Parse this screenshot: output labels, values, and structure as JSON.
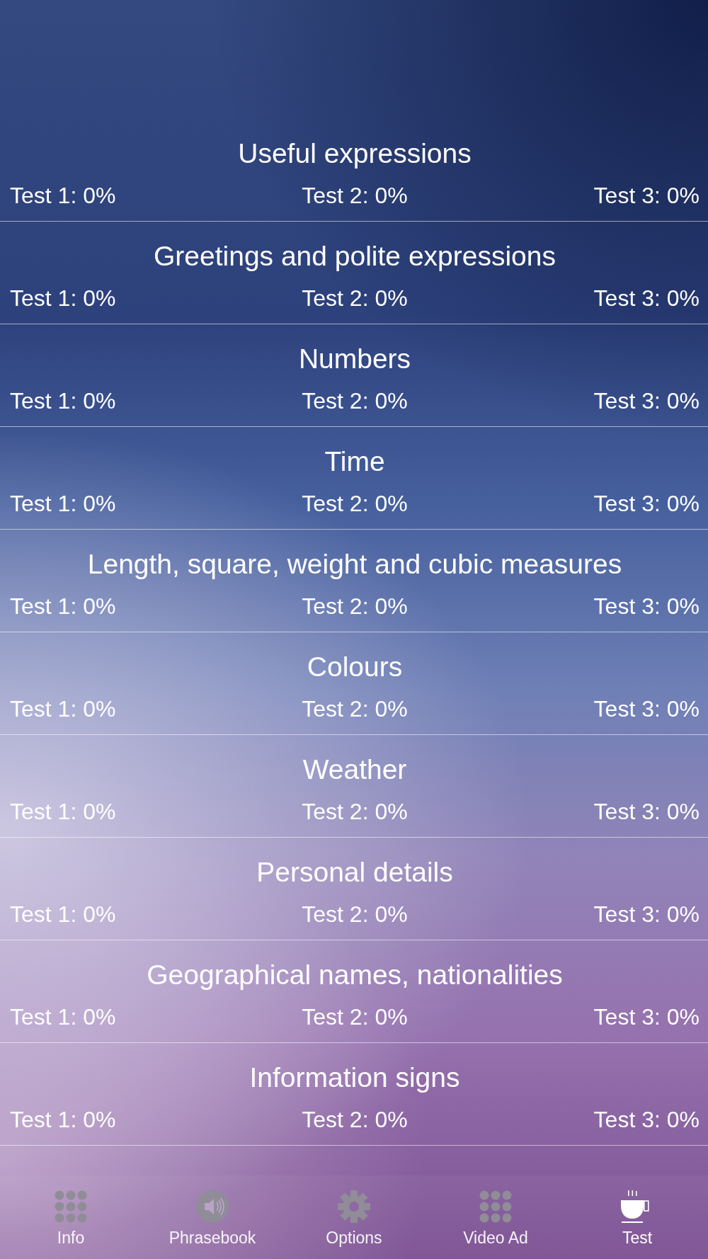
{
  "categories": [
    {
      "title": "Useful expressions",
      "scores": [
        "Test 1: 0%",
        "Test 2: 0%",
        "Test 3: 0%"
      ]
    },
    {
      "title": "Greetings and polite expressions",
      "scores": [
        "Test 1: 0%",
        "Test 2: 0%",
        "Test 3: 0%"
      ]
    },
    {
      "title": "Numbers",
      "scores": [
        "Test 1: 0%",
        "Test 2: 0%",
        "Test 3: 0%"
      ]
    },
    {
      "title": "Time",
      "scores": [
        "Test 1: 0%",
        "Test 2: 0%",
        "Test 3: 0%"
      ]
    },
    {
      "title": "Length, square, weight and cubic measures",
      "scores": [
        "Test 1: 0%",
        "Test 2: 0%",
        "Test 3: 0%"
      ]
    },
    {
      "title": "Colours",
      "scores": [
        "Test 1: 0%",
        "Test 2: 0%",
        "Test 3: 0%"
      ]
    },
    {
      "title": "Weather",
      "scores": [
        "Test 1: 0%",
        "Test 2: 0%",
        "Test 3: 0%"
      ]
    },
    {
      "title": "Personal details",
      "scores": [
        "Test 1: 0%",
        "Test 2: 0%",
        "Test 3: 0%"
      ]
    },
    {
      "title": "Geographical names, nationalities",
      "scores": [
        "Test 1: 0%",
        "Test 2: 0%",
        "Test 3: 0%"
      ]
    },
    {
      "title": "Information signs",
      "scores": [
        "Test 1: 0%",
        "Test 2: 0%",
        "Test 3: 0%"
      ]
    }
  ],
  "tab_bar": [
    {
      "label": "Info",
      "selected": false
    },
    {
      "label": "Phrasebook",
      "selected": false
    },
    {
      "label": "Options",
      "selected": false
    },
    {
      "label": "Video Ad",
      "selected": false
    },
    {
      "label": "Test",
      "selected": true
    }
  ]
}
